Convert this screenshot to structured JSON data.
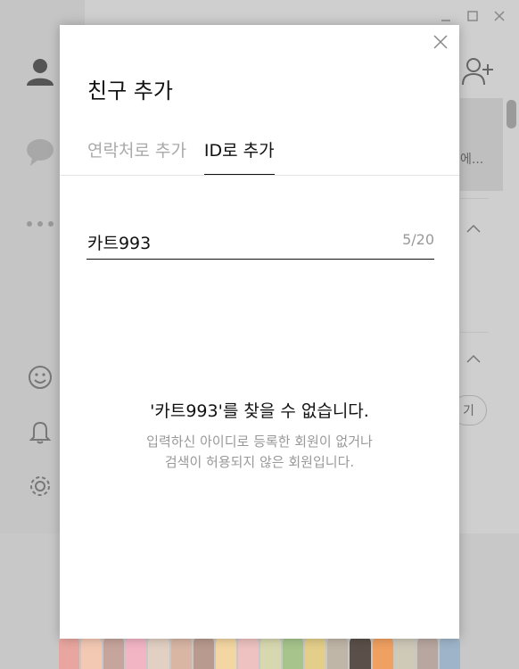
{
  "background": {
    "truncated_text": "에...",
    "button_partial": "기",
    "emoticon_colors": [
      "#e9a6a0",
      "#f3c9b3",
      "#c6a59c",
      "#f2b5c4",
      "#e2d0c3",
      "#d9b6a4",
      "#b89a8e",
      "#f4d6a3",
      "#eec2c0",
      "#d8d8b0",
      "#a6c48c",
      "#e4cf8a",
      "#c0b6a8",
      "#5a4f49",
      "#f0a060",
      "#cfc9b8",
      "#b8a7a0",
      "#9eb5c9"
    ]
  },
  "dialog": {
    "title": "친구 추가",
    "tabs": [
      {
        "label": "연락처로 추가",
        "active": false
      },
      {
        "label": "ID로 추가",
        "active": true
      }
    ],
    "id_field": {
      "value": "카트993",
      "counter": "5/20"
    },
    "message": {
      "main": "'카트993'를 찾을 수 없습니다.",
      "sub_line1": "입력하신 아이디로 등록한 회원이 없거나",
      "sub_line2": "검색이 허용되지 않은 회원입니다."
    }
  }
}
